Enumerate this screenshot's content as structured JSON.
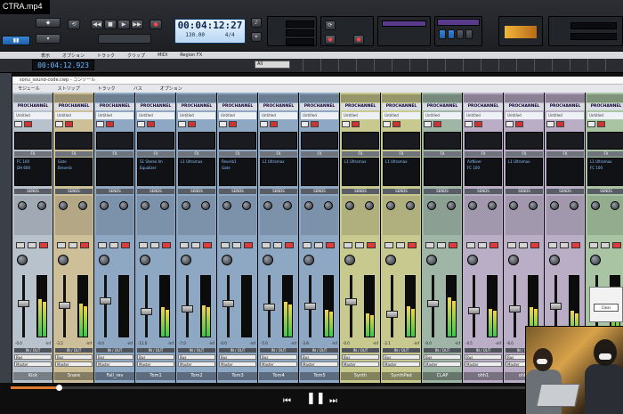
{
  "video": {
    "title": "CTRA.mp4"
  },
  "transport": {
    "time": "00:04:12:27",
    "tempo": "130.00",
    "meter": "4/4",
    "sub_time": "00:04:12.923"
  },
  "track_view": {
    "menu": [
      "表示",
      "オプション",
      "トラック",
      "クリップ",
      "MIDI",
      "Region FX"
    ],
    "filter": "All"
  },
  "console": {
    "window_title": "sonu_sound-code.cwp - コンソール",
    "menu": [
      "モジュール",
      "ストリップ",
      "トラック",
      "バス",
      "オプション"
    ]
  },
  "strips": [
    {
      "name": "Kick",
      "color": "#b8c2cd",
      "pc": "PROCHANNEL",
      "eq": "Untitled",
      "fx": [
        "FC 100",
        "DH 600"
      ],
      "route_a": "Bus",
      "route_b": "Master",
      "val_l": "-0.0",
      "val_r": "-inf"
    },
    {
      "name": "Snare",
      "color": "#cdbf98",
      "pc": "PROCHANNEL",
      "eq": "Untitled",
      "fx": [
        "Gate",
        "Breverb"
      ],
      "route_a": "Bus",
      "route_b": "Master",
      "val_l": "-3.2",
      "val_r": "-inf"
    },
    {
      "name": "Fall_rev",
      "color": "#8ea7c2",
      "pc": "PROCHANNEL",
      "eq": "Untitled",
      "fx": [],
      "route_a": "Bus",
      "route_b": "Master",
      "val_l": "-0.0",
      "val_r": "-inf"
    },
    {
      "name": "Tom1",
      "color": "#8ea7c2",
      "pc": "PROCHANNEL",
      "eq": "Untitled",
      "fx": [
        "S1 Stereo Im",
        "Equalizer"
      ],
      "route_a": "Bus",
      "route_b": "Master",
      "val_l": "-11.0",
      "val_r": "-inf"
    },
    {
      "name": "Tom2",
      "color": "#8ea7c2",
      "pc": "PROCHANNEL",
      "eq": "Untitled",
      "fx": [
        "L1 Ultramax"
      ],
      "route_a": "Bus",
      "route_b": "Master",
      "val_l": "-7.0",
      "val_r": "-inf"
    },
    {
      "name": "Tom3",
      "color": "#8ea7c2",
      "pc": "PROCHANNEL",
      "eq": "Untitled",
      "fx": [
        "Reverb1",
        "Gate"
      ],
      "route_a": "Bus",
      "route_b": "Master",
      "val_l": "-0.0",
      "val_r": "-inf"
    },
    {
      "name": "Tom4",
      "color": "#8ea7c2",
      "pc": "PROCHANNEL",
      "eq": "Untitled",
      "fx": [
        "L1 Ultramax"
      ],
      "route_a": "Bus",
      "route_b": "Master",
      "val_l": "-5.0",
      "val_r": "-inf"
    },
    {
      "name": "Tom5",
      "color": "#8ea7c2",
      "pc": "PROCHANNEL",
      "eq": "Untitled",
      "fx": [],
      "route_a": "Bus",
      "route_b": "Master",
      "val_l": "-3.8",
      "val_r": "-inf"
    },
    {
      "name": "Synth",
      "color": "#c8c98f",
      "pc": "PROCHANNEL",
      "eq": "Untitled",
      "fx": [
        "L1 Ultramax"
      ],
      "route_a": "Bus",
      "route_b": "Master",
      "val_l": "-0.0",
      "val_r": "-inf"
    },
    {
      "name": "SynthPad",
      "color": "#c8c98f",
      "pc": "PROCHANNEL",
      "eq": "Untitled",
      "fx": [
        "L1 Ultramax"
      ],
      "route_a": "Bus",
      "route_b": "Master",
      "val_l": "-2.1",
      "val_r": "-inf"
    },
    {
      "name": "CLAP",
      "color": "#9fb6a7",
      "pc": "PROCHANNEL",
      "eq": "Untitled",
      "fx": [],
      "route_a": "Bus",
      "route_b": "Master",
      "val_l": "-0.0",
      "val_r": "-inf"
    },
    {
      "name": "ohh1",
      "color": "#b9aec6",
      "pc": "PROCHANNEL",
      "eq": "Untitled",
      "fx": [
        "AirNiver",
        "FC 100"
      ],
      "route_a": "Bus",
      "route_b": "Master",
      "val_l": "-4.5",
      "val_r": "-inf"
    },
    {
      "name": "ohh2",
      "color": "#b9aec6",
      "pc": "PROCHANNEL",
      "eq": "Untitled",
      "fx": [
        "L1 Ultramax"
      ],
      "route_a": "Bus",
      "route_b": "Master",
      "val_l": "-6.0",
      "val_r": "-inf"
    },
    {
      "name": "Bass",
      "color": "#b9aec6",
      "pc": "PROCHANNEL",
      "eq": "Untitled",
      "fx": [],
      "route_a": "Bus",
      "route_b": "Master",
      "val_l": "-0.0",
      "val_r": "-inf"
    },
    {
      "name": "Lead",
      "color": "#a9c4a2",
      "pc": "PROCHANNEL",
      "eq": "Untitled",
      "fx": [
        "L1 Ultramax",
        "FC 100"
      ],
      "route_a": "Bus",
      "route_b": "Master",
      "val_l": "-2.0",
      "val_r": "-inf"
    }
  ],
  "strip_levels": [
    0.62,
    0.55,
    0.0,
    0.48,
    0.52,
    0.0,
    0.58,
    0.44,
    0.38,
    0.5,
    0.64,
    0.46,
    0.49,
    0.42,
    0.6
  ],
  "fader_positions": [
    0.55,
    0.52,
    0.6,
    0.4,
    0.45,
    0.55,
    0.48,
    0.5,
    0.58,
    0.35,
    0.55,
    0.42,
    0.45,
    0.5,
    0.52
  ],
  "tiny_window": {
    "button": "Clear"
  },
  "player": {
    "progress": 0.08
  }
}
